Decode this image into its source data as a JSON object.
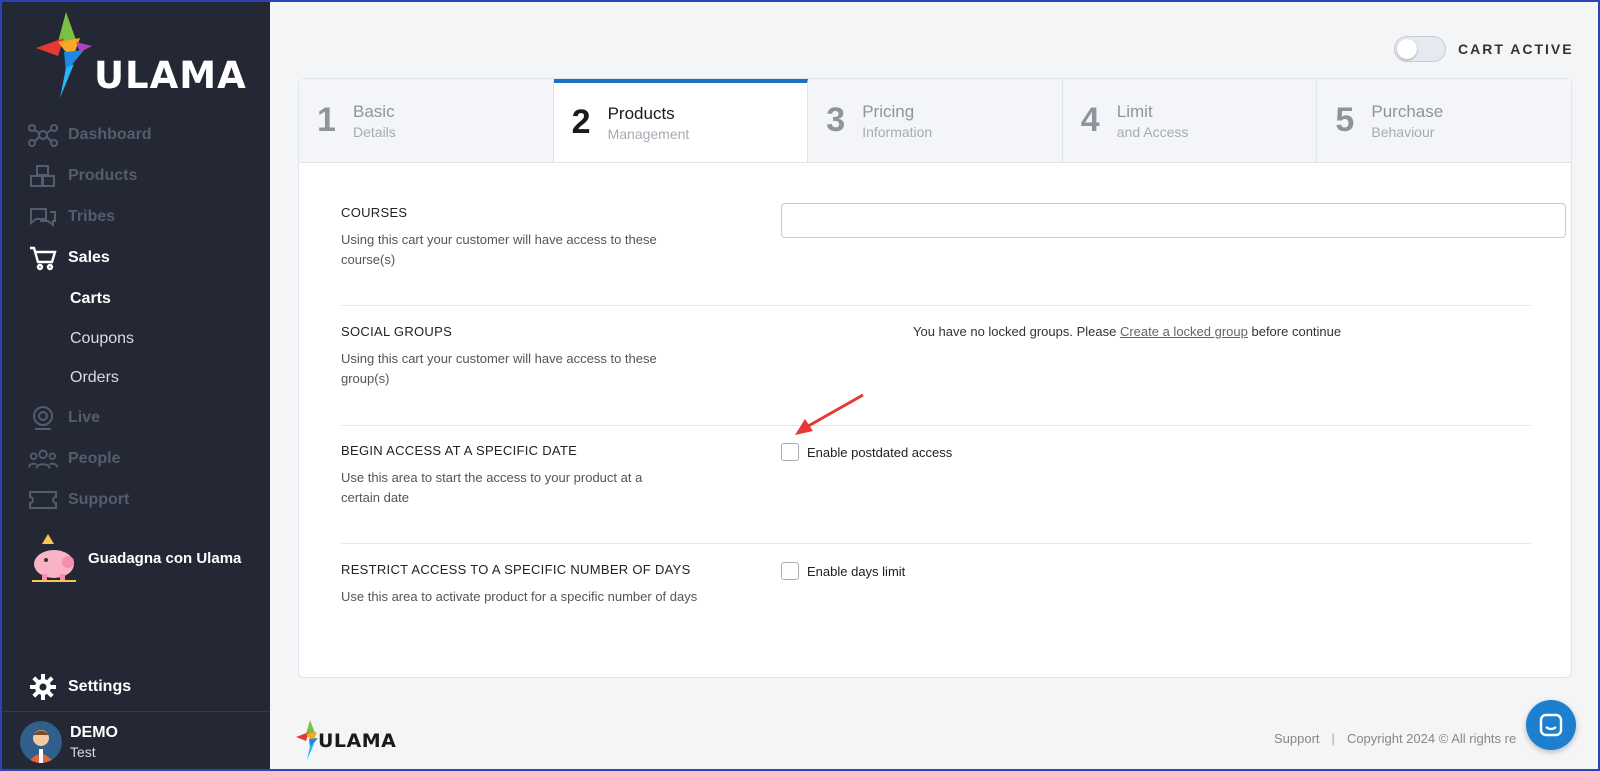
{
  "brand": {
    "name": "ULAMA"
  },
  "sidebar": {
    "items": [
      {
        "label": "Dashboard",
        "icon": "nodes-icon"
      },
      {
        "label": "Products",
        "icon": "boxes-icon"
      },
      {
        "label": "Tribes",
        "icon": "chat-bubbles-icon"
      },
      {
        "label": "Sales",
        "icon": "cart-icon"
      },
      {
        "label": "Live",
        "icon": "webcam-icon"
      },
      {
        "label": "People",
        "icon": "people-icon"
      },
      {
        "label": "Support",
        "icon": "ticket-icon"
      }
    ],
    "sales_sub": [
      "Carts",
      "Coupons",
      "Orders"
    ],
    "promo_label": "Guadagna con Ulama",
    "settings_label": "Settings",
    "user": {
      "name": "DEMO",
      "sub": "Test"
    }
  },
  "header": {
    "toggle_label": "CART ACTIVE",
    "toggle_on": false
  },
  "steps": [
    {
      "num": "1",
      "title": "Basic",
      "sub": "Details"
    },
    {
      "num": "2",
      "title": "Products",
      "sub": "Management"
    },
    {
      "num": "3",
      "title": "Pricing",
      "sub": "Information"
    },
    {
      "num": "4",
      "title": "Limit",
      "sub": "and Access"
    },
    {
      "num": "5",
      "title": "Purchase",
      "sub": "Behaviour"
    }
  ],
  "sections": {
    "courses": {
      "title": "COURSES",
      "desc": "Using this cart your customer will have access to these course(s)",
      "value": ""
    },
    "groups": {
      "title": "SOCIAL GROUPS",
      "desc": "Using this cart your customer will have access to these group(s)",
      "msg_before": "You have no locked groups. Please ",
      "msg_link": "Create a locked group",
      "msg_after": " before continue"
    },
    "begin": {
      "title": "BEGIN ACCESS AT A SPECIFIC DATE",
      "desc": "Use this area to start the access to your product at a certain date",
      "check_label": "Enable postdated access"
    },
    "restrict": {
      "title": "RESTRICT ACCESS TO A SPECIFIC NUMBER OF DAYS",
      "desc": "Use this area to activate product for a specific number of days",
      "check_label": "Enable days limit"
    }
  },
  "footer": {
    "logo": "ULAMA",
    "support": "Support",
    "separator": "|",
    "copyright": "Copyright 2024 © All rights re"
  },
  "colors": {
    "accent": "#1b6fc4",
    "sidebar": "#232834",
    "arrow": "#e53935"
  }
}
